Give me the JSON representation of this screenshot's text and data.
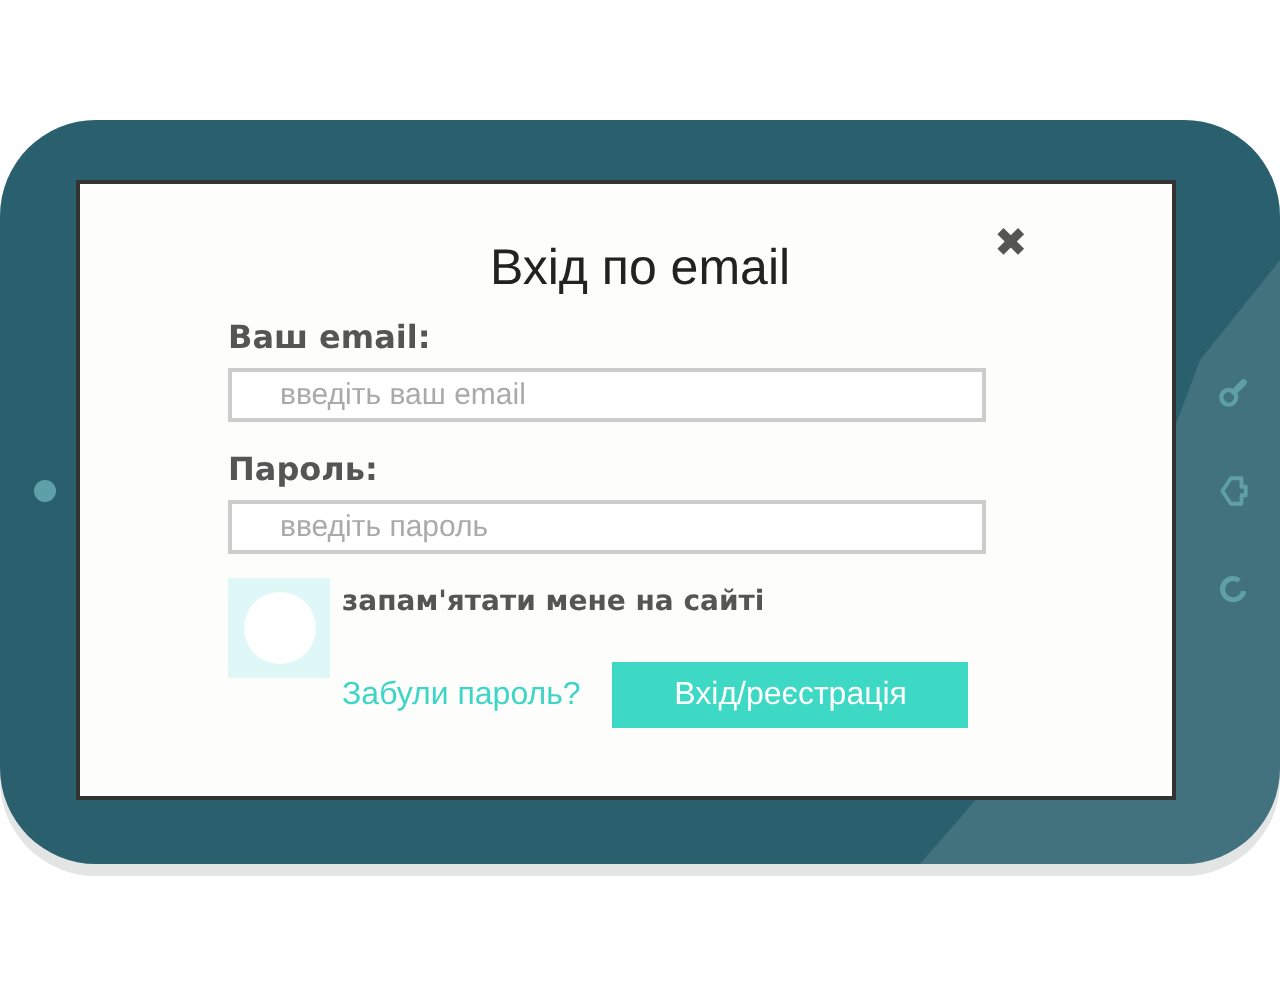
{
  "dialog": {
    "title": "Вхід по email",
    "close": "✖"
  },
  "fields": [
    {
      "label": "Ваш email:",
      "placeholder": "введіть ваш email"
    },
    {
      "label": "Пароль:",
      "placeholder": "введіть пароль"
    }
  ],
  "remember": {
    "label": "запам'ятати мене на сайті",
    "checked": false
  },
  "forgot_link": "Забули пароль?",
  "submit_button": "Вхід/реєстрація"
}
